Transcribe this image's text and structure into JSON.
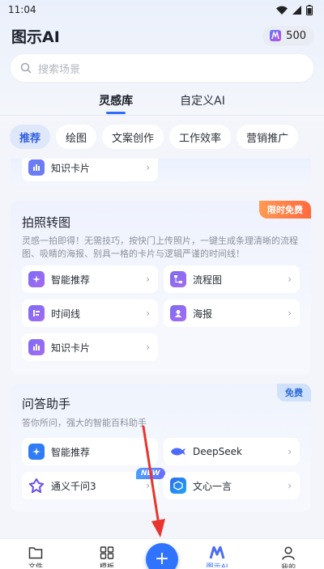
{
  "status_bar": {
    "time": "11:04"
  },
  "header": {
    "title": "图示AI",
    "credits": "500"
  },
  "search": {
    "placeholder": "搜索场景"
  },
  "main_tabs": [
    "灵感库",
    "自定义AI"
  ],
  "categories": [
    "推荐",
    "绘图",
    "文案创作",
    "工作效率",
    "营销推广"
  ],
  "partial_card": {
    "tool": "知识卡片"
  },
  "photo_card": {
    "title": "拍照转图",
    "badge": "限时免费",
    "description": "灵感一拍即得！无需技巧，按快门上传照片，一键生成条理清晰的流程图、吸睛的海报、别具一格的卡片与逻辑严谨的时间线！",
    "tools": [
      "智能推荐",
      "流程图",
      "时间线",
      "海报",
      "知识卡片"
    ]
  },
  "qa_card": {
    "title": "问答助手",
    "badge": "免费",
    "description": "答你所问，强大的智能百科助手",
    "tools": [
      "智能推荐",
      "DeepSeek",
      "通义千问3",
      "文心一言"
    ],
    "new_tag": "NEW"
  },
  "bottom_nav": {
    "items": [
      "文件",
      "模板",
      "图示AI",
      "我的"
    ]
  },
  "colors": {
    "accent": "#2f6bff",
    "arrow": "#e8352e",
    "hot_badge": "#ff7a45"
  }
}
